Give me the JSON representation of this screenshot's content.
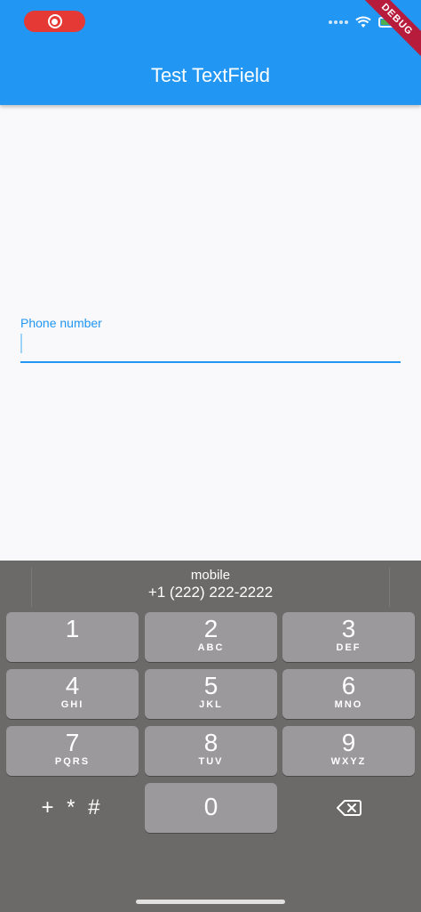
{
  "app_bar": {
    "title": "Test TextField",
    "color": "#2196f3"
  },
  "status_bar": {
    "debug_banner": "DEBUG"
  },
  "text_field": {
    "label": "Phone number",
    "value": "",
    "accent": "#2196f3"
  },
  "keyboard": {
    "suggestion": {
      "line1": "mobile",
      "line2": "+1 (222) 222-2222"
    },
    "keys": [
      {
        "digit": "1",
        "letters": ""
      },
      {
        "digit": "2",
        "letters": "ABC"
      },
      {
        "digit": "3",
        "letters": "DEF"
      },
      {
        "digit": "4",
        "letters": "GHI"
      },
      {
        "digit": "5",
        "letters": "JKL"
      },
      {
        "digit": "6",
        "letters": "MNO"
      },
      {
        "digit": "7",
        "letters": "PQRS"
      },
      {
        "digit": "8",
        "letters": "TUV"
      },
      {
        "digit": "9",
        "letters": "WXYZ"
      },
      {
        "digit": "0",
        "letters": ""
      }
    ],
    "symbols_key": "+ * #",
    "backspace_icon": "backspace-icon"
  }
}
